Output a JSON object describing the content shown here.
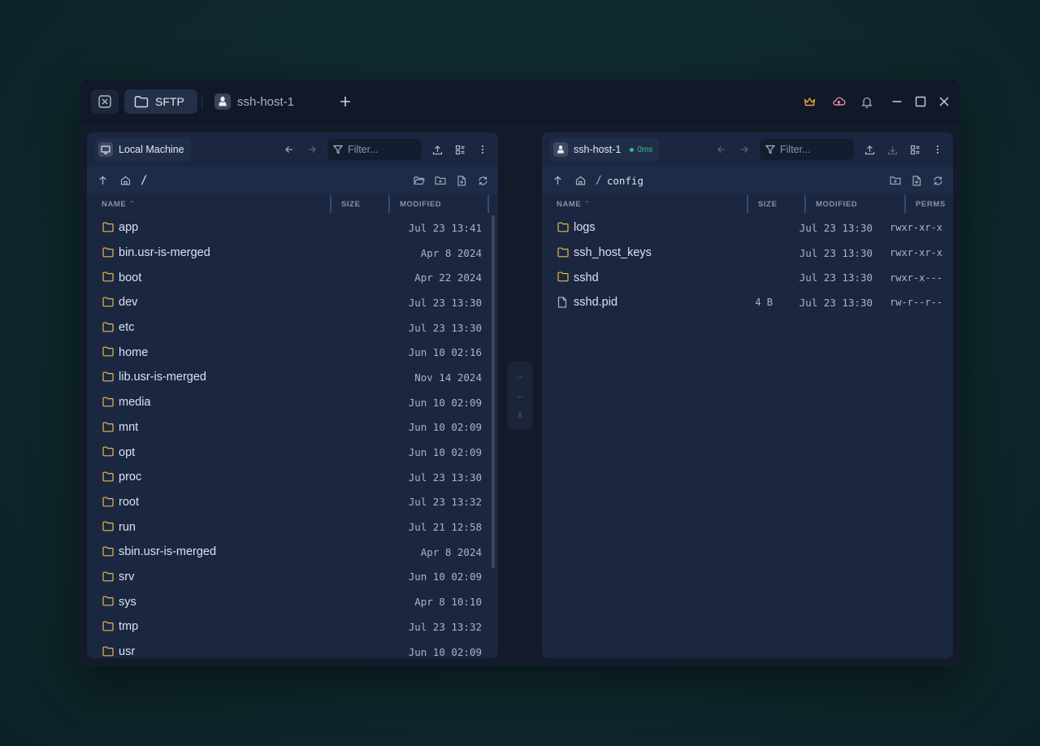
{
  "titlebar": {
    "tabs": [
      {
        "label": "SFTP",
        "icon": "folder-icon",
        "active": true
      },
      {
        "label": "ssh-host-1",
        "icon": "linux-icon",
        "active": false
      }
    ]
  },
  "left": {
    "host": "Local Machine",
    "filter_placeholder": "Filter...",
    "path": "/",
    "columns": {
      "name": "NAME",
      "size": "SIZE",
      "modified": "MODIFIED"
    },
    "rows": [
      {
        "name": "app",
        "modified": "Jul 23 13:41"
      },
      {
        "name": "bin.usr-is-merged",
        "modified": "Apr 8 2024"
      },
      {
        "name": "boot",
        "modified": "Apr 22 2024"
      },
      {
        "name": "dev",
        "modified": "Jul 23 13:30"
      },
      {
        "name": "etc",
        "modified": "Jul 23 13:30"
      },
      {
        "name": "home",
        "modified": "Jun 10 02:16"
      },
      {
        "name": "lib.usr-is-merged",
        "modified": "Nov 14 2024"
      },
      {
        "name": "media",
        "modified": "Jun 10 02:09"
      },
      {
        "name": "mnt",
        "modified": "Jun 10 02:09"
      },
      {
        "name": "opt",
        "modified": "Jun 10 02:09"
      },
      {
        "name": "proc",
        "modified": "Jul 23 13:30"
      },
      {
        "name": "root",
        "modified": "Jul 23 13:32"
      },
      {
        "name": "run",
        "modified": "Jul 21 12:58"
      },
      {
        "name": "sbin.usr-is-merged",
        "modified": "Apr 8 2024"
      },
      {
        "name": "srv",
        "modified": "Jun 10 02:09"
      },
      {
        "name": "sys",
        "modified": "Apr 8 10:10"
      },
      {
        "name": "tmp",
        "modified": "Jul 23 13:32"
      },
      {
        "name": "usr",
        "modified": "Jun 10 02:09"
      }
    ]
  },
  "right": {
    "host": "ssh-host-1",
    "latency": "0ms",
    "filter_placeholder": "Filter...",
    "path_root": "/",
    "path": "config",
    "columns": {
      "name": "NAME",
      "size": "SIZE",
      "modified": "MODIFIED",
      "perms": "PERMS"
    },
    "rows": [
      {
        "name": "logs",
        "type": "folder",
        "size": "",
        "modified": "Jul 23 13:30",
        "perms": "rwxr-xr-x"
      },
      {
        "name": "ssh_host_keys",
        "type": "folder",
        "size": "",
        "modified": "Jul 23 13:30",
        "perms": "rwxr-xr-x"
      },
      {
        "name": "sshd",
        "type": "folder",
        "size": "",
        "modified": "Jul 23 13:30",
        "perms": "rwxr-x---"
      },
      {
        "name": "sshd.pid",
        "type": "file",
        "size": "4 B",
        "modified": "Jul 23 13:30",
        "perms": "rw-r--r--"
      }
    ]
  },
  "transfer": {
    "right_arrow": "→",
    "left_arrow": "←",
    "both": "±"
  },
  "colors": {
    "folder": "#e8b84a",
    "online": "#35c077",
    "crown": "#e0a33a",
    "cloud": "#e58aa0"
  }
}
